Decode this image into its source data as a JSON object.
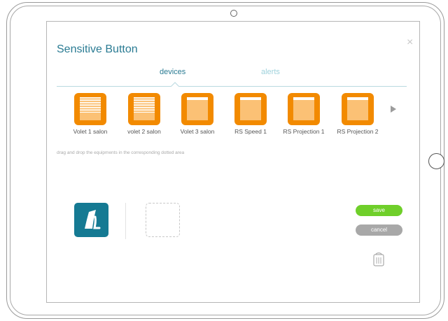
{
  "dialog": {
    "title": "Sensitive Button",
    "close_label": "×",
    "tabs": [
      {
        "label": "devices",
        "active": true
      },
      {
        "label": "alerts",
        "active": false
      }
    ],
    "devices": [
      {
        "label": "Volet 1 salon",
        "icon": "blind-slats-icon"
      },
      {
        "label": "volet 2 salon",
        "icon": "blind-slats-icon"
      },
      {
        "label": "Volet 3 salon",
        "icon": "shutter-icon"
      },
      {
        "label": "RS Speed 1",
        "icon": "shutter-icon"
      },
      {
        "label": "RS Projection 1",
        "icon": "shutter-icon"
      },
      {
        "label": "RS Projection 2",
        "icon": "shutter-icon"
      }
    ],
    "hint": "drag and drop the equipments in the corresponding dotted area",
    "save_label": "save",
    "cancel_label": "cancel"
  },
  "colors": {
    "accent": "#2a7b93",
    "device_orange": "#f28a00",
    "save_green": "#6fcf2a",
    "cancel_gray": "#a8a8a8",
    "sensor_tile": "#157a93"
  }
}
